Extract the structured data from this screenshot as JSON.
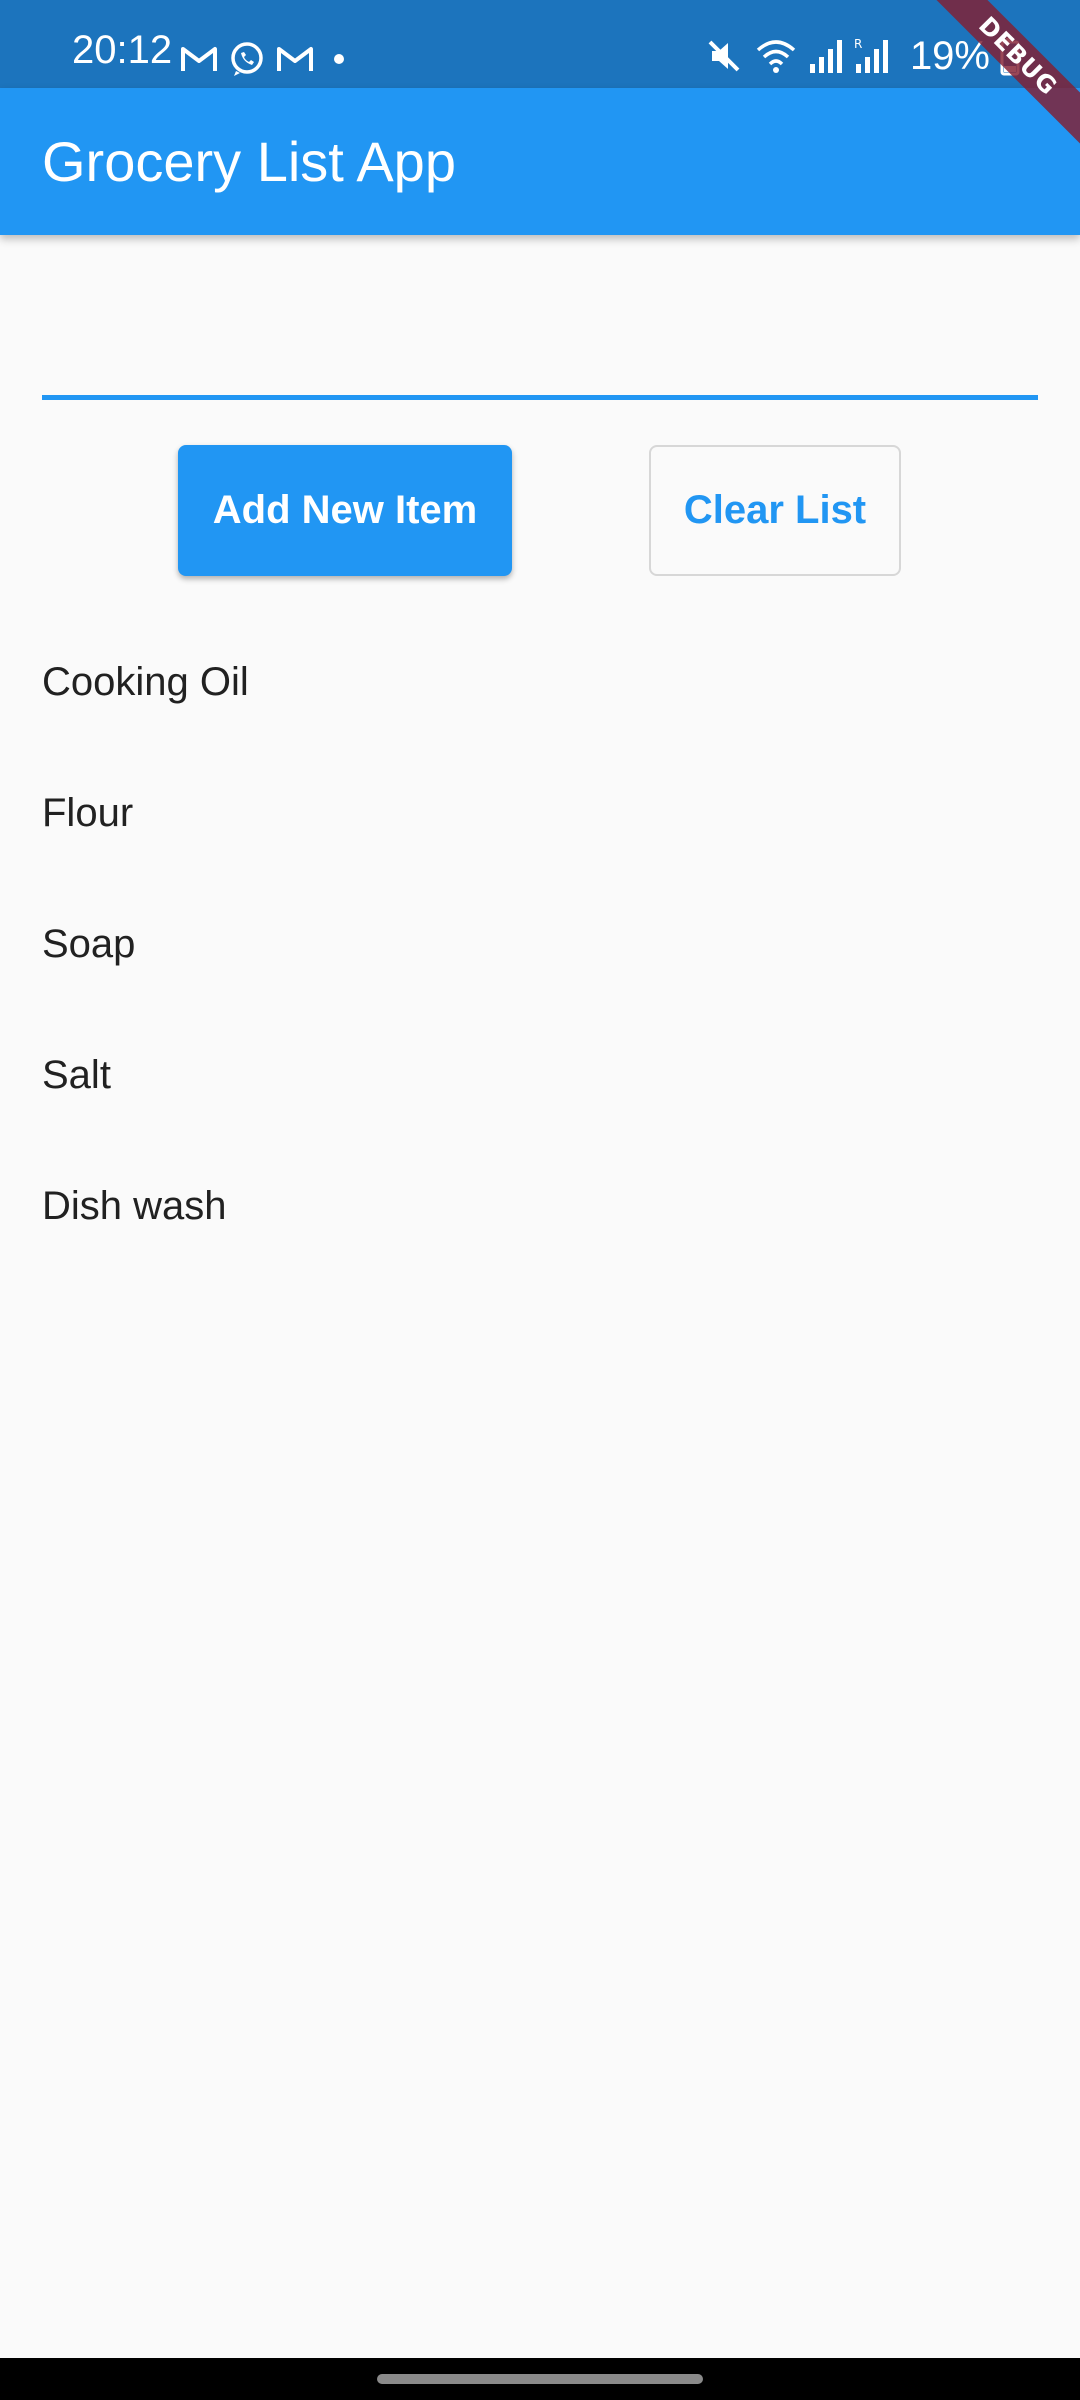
{
  "status_bar": {
    "time": "20:12",
    "battery": "19%",
    "left_icons": [
      "gmail-icon",
      "whatsapp-icon",
      "gmail-icon",
      "dot-icon"
    ],
    "right_icons": [
      "mute-icon",
      "wifi-icon",
      "signal-icon",
      "roaming-signal-icon",
      "battery-icon"
    ]
  },
  "debug_banner": "DEBUG",
  "app_bar": {
    "title": "Grocery List App"
  },
  "input": {
    "value": "",
    "placeholder": ""
  },
  "actions": {
    "add_label": "Add New Item",
    "clear_label": "Clear List"
  },
  "items": [
    {
      "label": "Cooking Oil"
    },
    {
      "label": "Flour"
    },
    {
      "label": "Soap"
    },
    {
      "label": "Salt"
    },
    {
      "label": "Dish wash"
    }
  ],
  "colors": {
    "primary": "#2196F3",
    "status_bar": "#1C74BD",
    "background": "#FAFAFA",
    "text": "#212121"
  }
}
